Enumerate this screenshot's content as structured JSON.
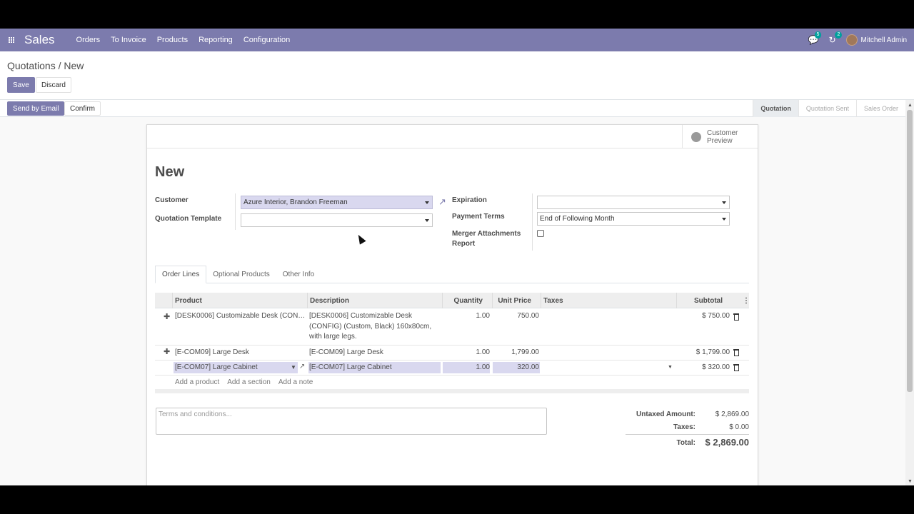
{
  "navbar": {
    "brand": "Sales",
    "menu": [
      "Orders",
      "To Invoice",
      "Products",
      "Reporting",
      "Configuration"
    ],
    "messages_count": "5",
    "activities_count": "2",
    "user": "Mitchell Admin",
    "accent_color": "#7c7bad"
  },
  "control_panel": {
    "breadcrumb_root": "Quotations",
    "breadcrumb_separator": "/",
    "breadcrumb_current": "New",
    "save_label": "Save",
    "discard_label": "Discard"
  },
  "statusbar": {
    "send_email_label": "Send by Email",
    "confirm_label": "Confirm",
    "stages": [
      "Quotation",
      "Quotation Sent",
      "Sales Order"
    ],
    "active_stage": "Quotation"
  },
  "form": {
    "preview_label": "Customer Preview",
    "title": "New",
    "customer_label": "Customer",
    "customer_value": "Azure Interior, Brandon Freeman",
    "template_label": "Quotation Template",
    "template_value": "",
    "expiration_label": "Expiration",
    "expiration_value": "",
    "payment_terms_label": "Payment Terms",
    "payment_terms_value": "End of Following Month",
    "merger_label": "Merger Attachments Report",
    "merger_checked": false
  },
  "tabs": [
    "Order Lines",
    "Optional Products",
    "Other Info"
  ],
  "order_lines": {
    "columns": {
      "product": "Product",
      "description": "Description",
      "quantity": "Quantity",
      "unit_price": "Unit Price",
      "taxes": "Taxes",
      "subtotal": "Subtotal"
    },
    "rows": [
      {
        "product": "[DESK0006] Customizable Desk (CON…",
        "description": "[DESK0006] Customizable Desk (CONFIG) (Custom, Black) 160x80cm, with large legs.",
        "quantity": "1.00",
        "unit_price": "750.00",
        "taxes": "",
        "subtotal": "$ 750.00"
      },
      {
        "product": "[E-COM09] Large Desk",
        "description": "[E-COM09] Large Desk",
        "quantity": "1.00",
        "unit_price": "1,799.00",
        "taxes": "",
        "subtotal": "$ 1,799.00"
      },
      {
        "product": "[E-COM07] Large Cabinet",
        "description": "[E-COM07] Large Cabinet",
        "quantity": "1.00",
        "unit_price": "320.00",
        "taxes": "",
        "subtotal": "$ 320.00"
      }
    ],
    "add_product": "Add a product",
    "add_section": "Add a section",
    "add_note": "Add a note"
  },
  "terms_placeholder": "Terms and conditions...",
  "totals": {
    "untaxed_label": "Untaxed Amount:",
    "untaxed_value": "$ 2,869.00",
    "taxes_label": "Taxes:",
    "taxes_value": "$ 0.00",
    "total_label": "Total:",
    "total_value": "$ 2,869.00"
  }
}
